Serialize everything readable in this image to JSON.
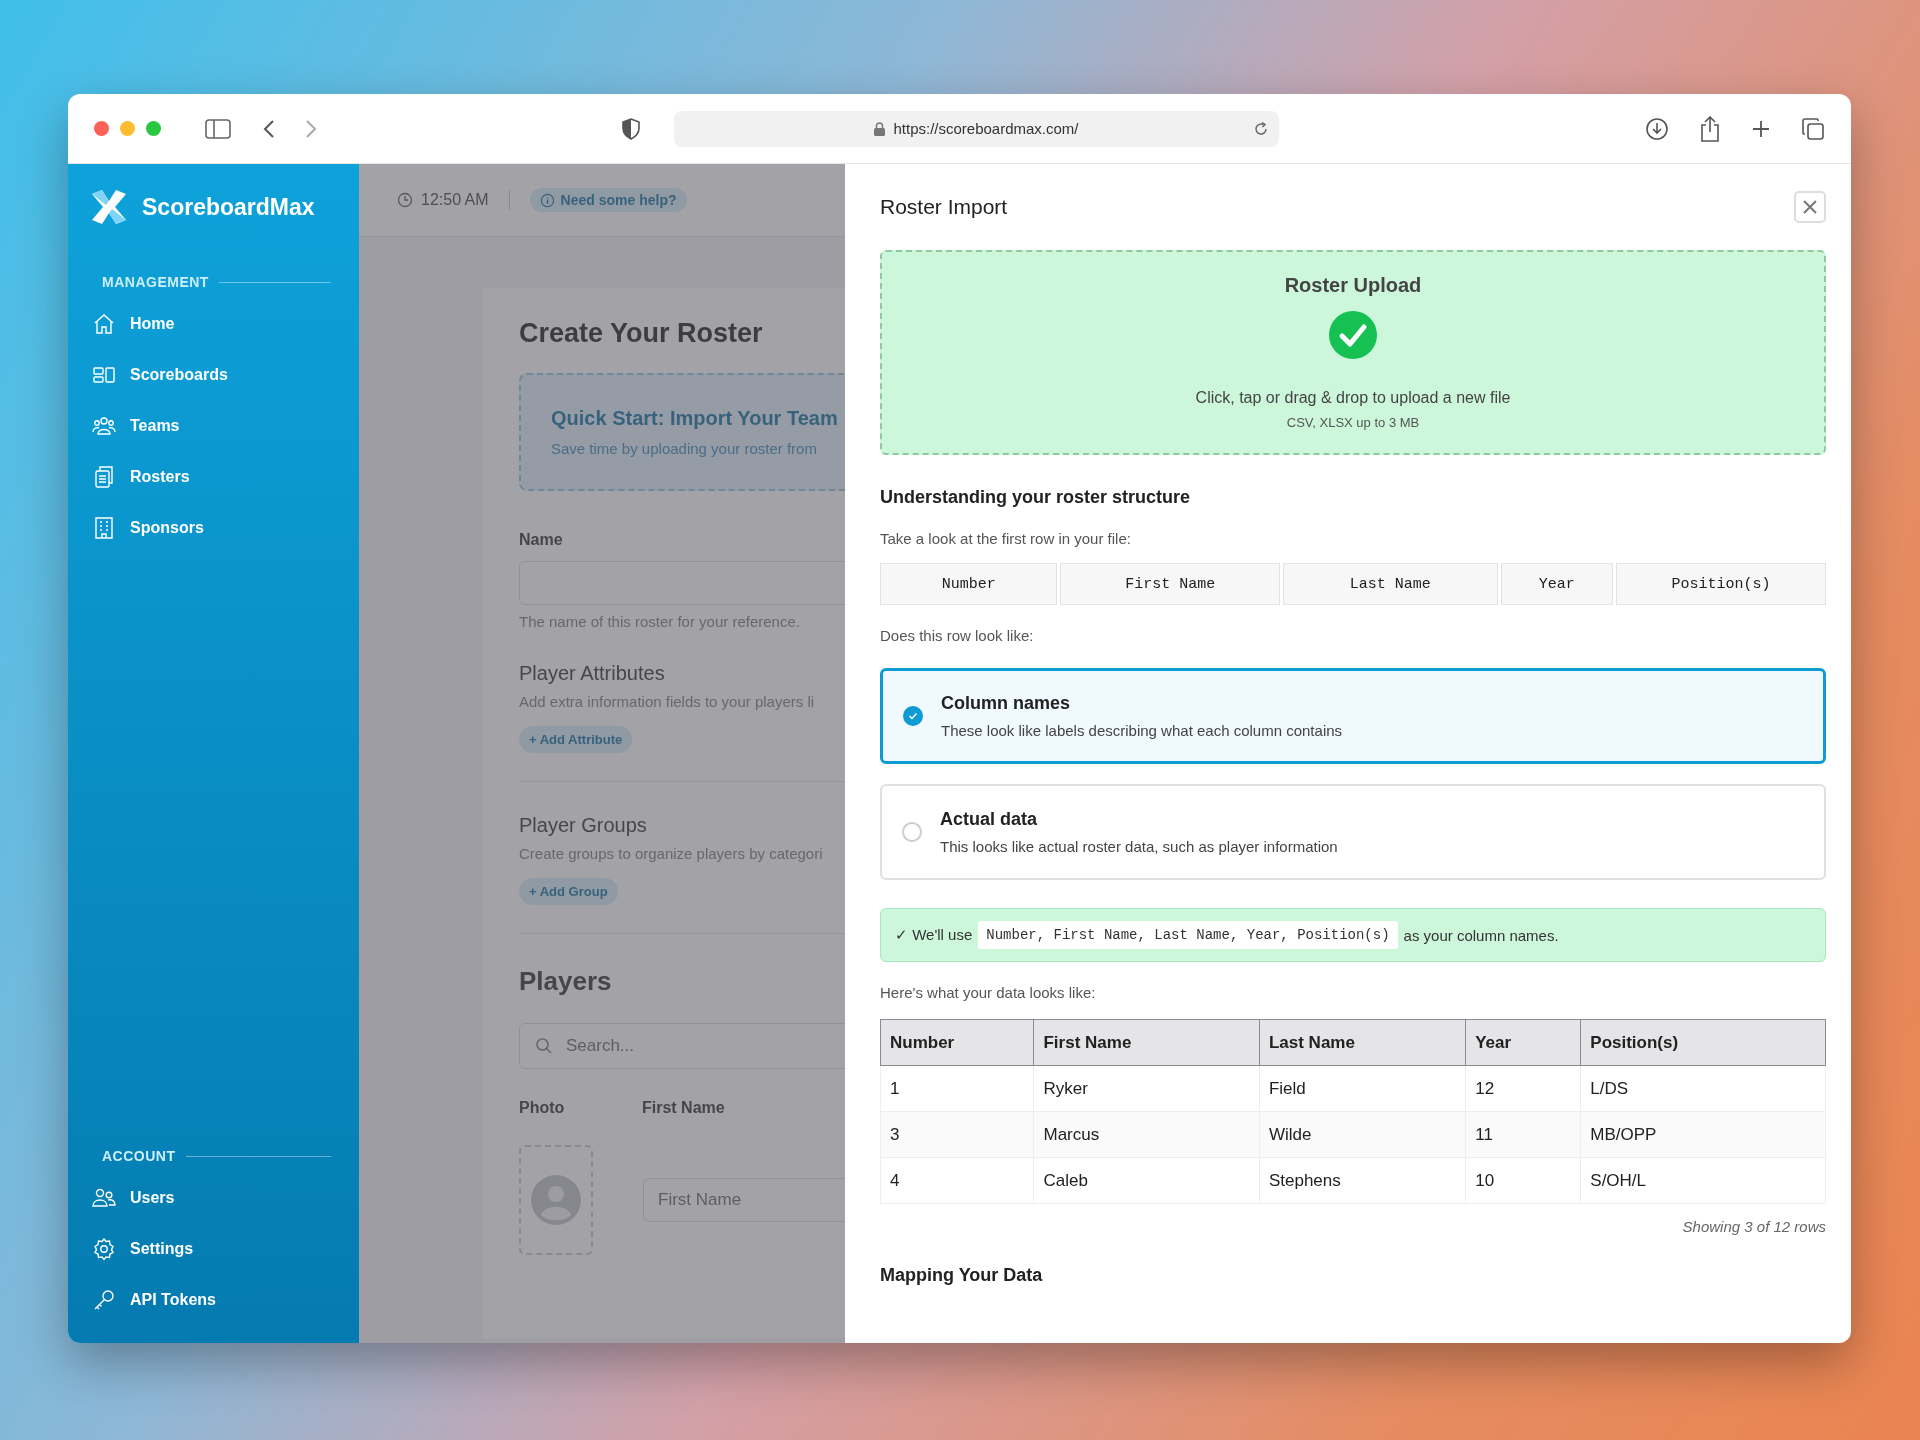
{
  "browser": {
    "url": "https://scoreboardmax.com/"
  },
  "sidebar": {
    "brand": "ScoreboardMax",
    "sections": [
      {
        "heading": "MANAGEMENT",
        "items": [
          {
            "label": "Home"
          },
          {
            "label": "Scoreboards"
          },
          {
            "label": "Teams"
          },
          {
            "label": "Rosters"
          },
          {
            "label": "Sponsors"
          }
        ]
      },
      {
        "heading": "ACCOUNT",
        "items": [
          {
            "label": "Users"
          },
          {
            "label": "Settings"
          },
          {
            "label": "API Tokens"
          }
        ]
      }
    ]
  },
  "topbar": {
    "time": "12:50 AM",
    "help": "Need some help?"
  },
  "page": {
    "title": "Create Your Roster",
    "quick_start": {
      "title": "Quick Start: Import Your Team",
      "text": "Save time by uploading your roster from"
    },
    "name_field": {
      "label": "Name",
      "hint": "The name of this roster for your reference."
    },
    "attributes": {
      "title": "Player Attributes",
      "text": "Add extra information fields to your players li",
      "button": "+ Add Attribute"
    },
    "groups": {
      "title": "Player Groups",
      "text": "Create groups to organize players by categori",
      "button": "+ Add Group"
    },
    "players": {
      "title": "Players",
      "search_placeholder": "Search...",
      "columns": [
        "Photo",
        "First Name"
      ],
      "first_name_placeholder": "First Name"
    }
  },
  "panel": {
    "title": "Roster Import",
    "upload": {
      "title": "Roster Upload",
      "text": "Click, tap or drag & drop to upload a new file",
      "note": "CSV, XLSX up to 3 MB"
    },
    "structure_heading": "Understanding your roster structure",
    "prompt": "Take a look at the first row in your file:",
    "first_row": [
      "Number",
      "First Name",
      "Last Name",
      "Year",
      "Position(s)"
    ],
    "question": "Does this row look like:",
    "options": [
      {
        "title": "Column names",
        "description": "These look like labels describing what each column contains",
        "selected": true
      },
      {
        "title": "Actual data",
        "description": "This looks like actual roster data, such as player information",
        "selected": false
      }
    ],
    "notice": {
      "prefix": "✓ We'll use",
      "code": "Number, First Name, Last Name, Year, Position(s)",
      "suffix": "as your column names."
    },
    "preview_label": "Here's what your data looks like:",
    "table": {
      "columns": [
        "Number",
        "First Name",
        "Last Name",
        "Year",
        "Position(s)"
      ],
      "rows": [
        [
          "1",
          "Ryker",
          "Field",
          "12",
          "L/DS"
        ],
        [
          "3",
          "Marcus",
          "Wilde",
          "11",
          "MB/OPP"
        ],
        [
          "4",
          "Caleb",
          "Stephens",
          "10",
          "S/OH/L"
        ]
      ]
    },
    "footnote": "Showing 3 of 12 rows",
    "next_heading": "Mapping Your Data"
  }
}
